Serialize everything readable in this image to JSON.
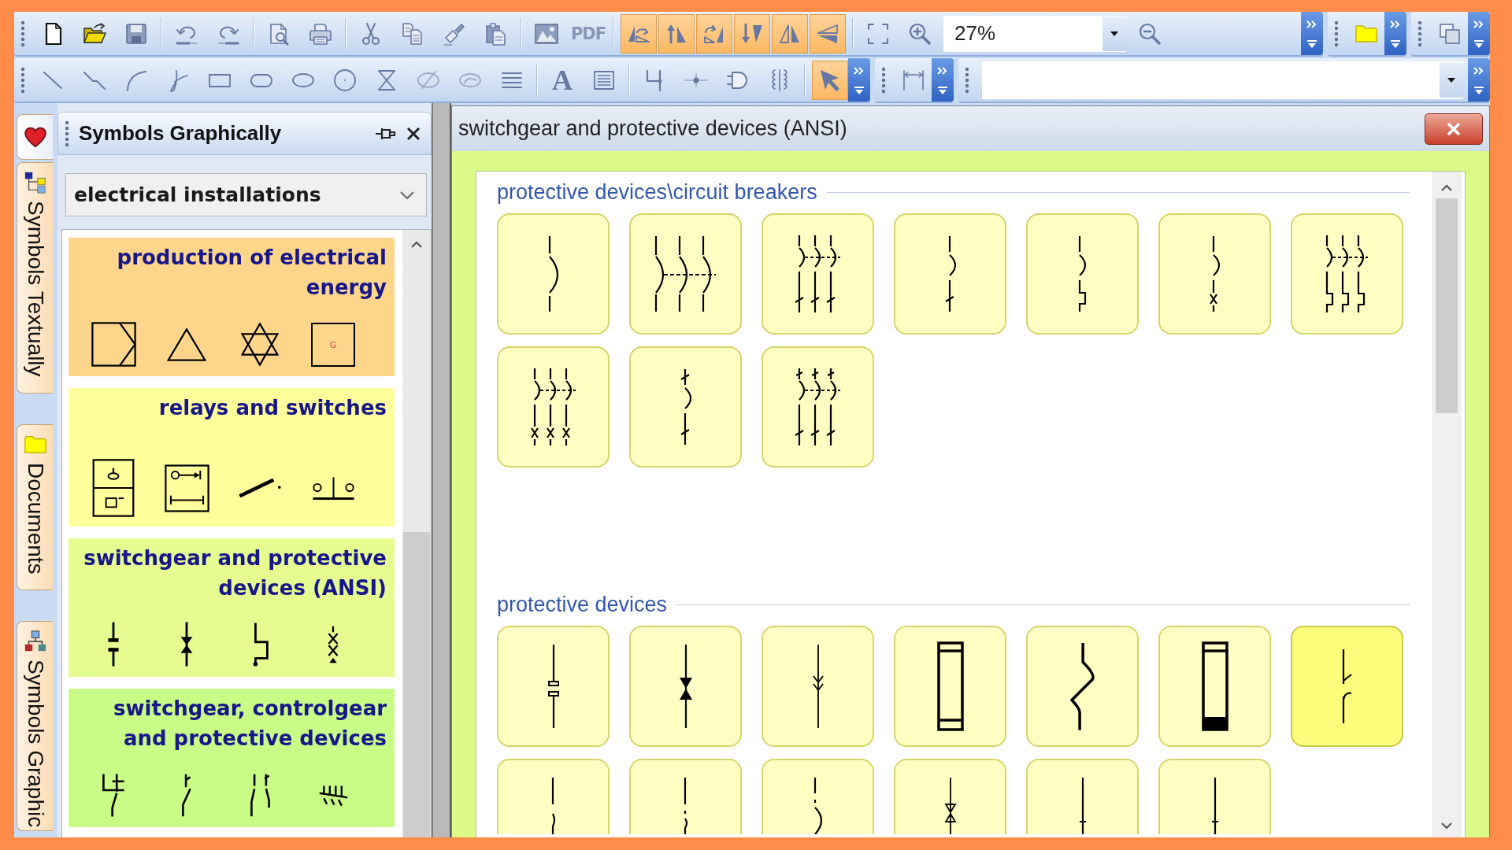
{
  "toolbars": [
    {
      "bands": [
        {
          "groups": [
            [
              {
                "kind": "new",
                "on": false
              },
              {
                "kind": "open",
                "on": false
              },
              {
                "kind": "save",
                "on": false
              }
            ],
            [
              {
                "kind": "undo",
                "on": false
              },
              {
                "kind": "redo",
                "on": false
              }
            ],
            [
              {
                "kind": "preview",
                "on": false
              },
              {
                "kind": "print",
                "on": false
              }
            ],
            [
              {
                "kind": "cut",
                "on": false
              },
              {
                "kind": "copy",
                "on": false
              },
              {
                "kind": "brush",
                "on": false
              },
              {
                "kind": "paste",
                "on": false
              }
            ],
            [
              {
                "kind": "picture",
                "on": false
              },
              {
                "kind": "pdf",
                "label": "PDF",
                "on": false
              }
            ],
            [
              {
                "kind": "rotateleft",
                "on": true
              },
              {
                "kind": "flipup",
                "on": true
              },
              {
                "kind": "rotateright",
                "on": true
              },
              {
                "kind": "flipdown",
                "on": true
              },
              {
                "kind": "mirrorx",
                "on": true
              },
              {
                "kind": "mirrory",
                "on": true
              }
            ],
            [
              {
                "kind": "fit",
                "on": false
              },
              {
                "kind": "zoomin",
                "on": false
              },
              {
                "kind": "combo",
                "value": "27%"
              },
              {
                "kind": "zoomout",
                "on": false
              }
            ]
          ]
        },
        {
          "groups": [
            [
              {
                "kind": "folder",
                "on": false
              }
            ]
          ]
        },
        {
          "groups": [
            [
              {
                "kind": "layers",
                "on": false
              }
            ]
          ]
        }
      ]
    },
    {
      "bands": [
        {
          "groups": [
            [
              {
                "kind": "line",
                "on": false
              },
              {
                "kind": "polyline",
                "on": false
              },
              {
                "kind": "arc",
                "on": false
              },
              {
                "kind": "curve",
                "on": false
              },
              {
                "kind": "rect",
                "on": false
              },
              {
                "kind": "roundrect",
                "on": false
              },
              {
                "kind": "ellipse",
                "on": false
              },
              {
                "kind": "circle",
                "on": false
              },
              {
                "kind": "hourglass",
                "on": false
              },
              {
                "kind": "slashellipse",
                "on": false
              },
              {
                "kind": "loop",
                "on": false
              },
              {
                "kind": "list",
                "on": false
              }
            ],
            [
              {
                "kind": "letter",
                "label": "A",
                "on": false
              },
              {
                "kind": "textframe",
                "on": false
              }
            ],
            [
              {
                "kind": "connector",
                "on": false
              },
              {
                "kind": "junction",
                "on": false
              },
              {
                "kind": "gate",
                "on": false
              },
              {
                "kind": "coil",
                "on": false
              }
            ],
            [
              {
                "kind": "pointer",
                "on": true
              }
            ]
          ]
        },
        {
          "groups": [
            [
              {
                "kind": "dimension",
                "on": false
              }
            ]
          ]
        },
        {
          "groups": [
            [
              {
                "kind": "combo"
              }
            ]
          ]
        }
      ]
    }
  ],
  "side_tabs": [
    {
      "kind": "favorites"
    },
    {
      "kind": "tree",
      "label": "Symbols Textually"
    },
    {
      "kind": "folder",
      "label": "Documents"
    },
    {
      "kind": "network",
      "label": "Symbols Graphic"
    }
  ],
  "panel": {
    "title": "Symbols Graphically",
    "dropdown": {
      "value": "electrical installations"
    },
    "categories": [
      {
        "title": "production of electrical energy",
        "color": "#fdd68c",
        "symbols": [
          {
            "kind": "converter"
          },
          {
            "kind": "triangle"
          },
          {
            "kind": "hexagram"
          },
          {
            "kind": "generator",
            "label": "G"
          }
        ]
      },
      {
        "title": "relays and switches",
        "color": "#ffff9b",
        "symbols": [
          {
            "kind": "relaybox"
          },
          {
            "kind": "timerbox"
          },
          {
            "kind": "switchlever"
          },
          {
            "kind": "contactpair"
          }
        ]
      },
      {
        "title": "switchgear and protective devices (ANSI)",
        "color": "#e6fc91",
        "symbols": [
          {
            "kind": "gap2"
          },
          {
            "kind": "arrester2"
          },
          {
            "kind": "step2"
          },
          {
            "kind": "cross2"
          }
        ]
      },
      {
        "title": "switchgear, controlgear and protective devices",
        "color": "#c8fc87",
        "symbols": [
          {
            "kind": "disc"
          },
          {
            "kind": "load"
          },
          {
            "kind": "double"
          },
          {
            "kind": "comb"
          }
        ]
      }
    ]
  },
  "dialog": {
    "title": "switchgear and protective devices (ANSI)",
    "sections": [
      {
        "title": "protective devices\\circuit breakers",
        "tiles": [
          {
            "kind": "breaker",
            "selected": false
          },
          {
            "kind": "breakerlinked",
            "selected": false
          },
          {
            "kind": "breakertrip3",
            "selected": false
          },
          {
            "kind": "breakertrip",
            "selected": false
          },
          {
            "kind": "breakerdelay",
            "selected": false
          },
          {
            "kind": "breakercross",
            "selected": false
          },
          {
            "kind": "breakerdelay3",
            "selected": false
          },
          {
            "kind": "breakercross3",
            "selected": false
          },
          {
            "kind": "breakerdouble",
            "selected": false
          },
          {
            "kind": "breakerdouble3",
            "selected": false
          }
        ]
      },
      {
        "title": "protective devices",
        "tiles": [
          {
            "kind": "sparkgap",
            "selected": false
          },
          {
            "kind": "arrester",
            "selected": false
          },
          {
            "kind": "surge",
            "selected": false
          },
          {
            "kind": "fuse",
            "selected": false
          },
          {
            "kind": "thermal",
            "selected": false
          },
          {
            "kind": "striker",
            "selected": false
          },
          {
            "kind": "contact",
            "selected": true
          },
          {
            "kind": "gapline",
            "selected": false
          },
          {
            "kind": "dashgap",
            "selected": false
          },
          {
            "kind": "arcgap",
            "selected": false
          },
          {
            "kind": "arrestertwin",
            "selected": false
          },
          {
            "kind": "plain",
            "selected": false
          },
          {
            "kind": "plain",
            "selected": false
          }
        ]
      }
    ]
  }
}
